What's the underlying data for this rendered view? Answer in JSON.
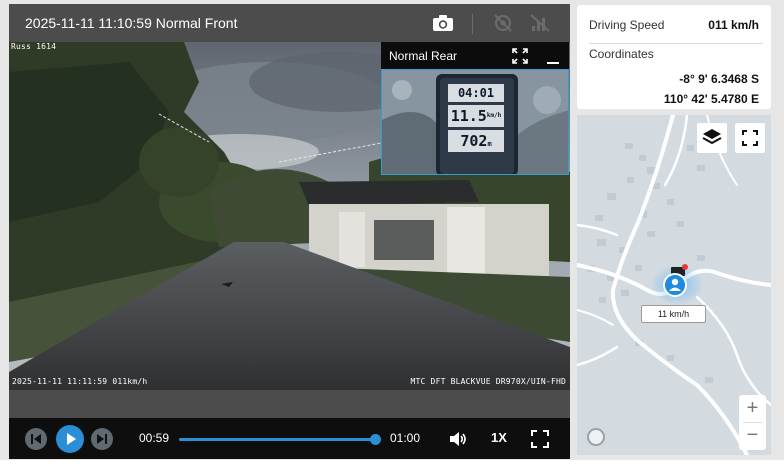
{
  "video": {
    "title": "2025-11-11 11:10:59 Normal Front",
    "osd_corner": "Russ 1614",
    "osd_left": "2025-11-11 11:11:59 011km/h",
    "osd_right": "MTC DFT BLACKVUE DR970X/UIN-FHD",
    "toolbar_icons": [
      "camera-icon",
      "no-gps-icon",
      "no-signal-icon"
    ]
  },
  "rear": {
    "title": "Normal Rear",
    "gauge_time": "04:01",
    "gauge_speed": "11.5",
    "gauge_speed_unit": "km/h",
    "gauge_distance": "702",
    "gauge_distance_unit": "m"
  },
  "controls": {
    "current_time": "00:59",
    "total_time": "01:00",
    "progress": 0.983,
    "playback_rate": "1X"
  },
  "info": {
    "speed_label": "Driving Speed",
    "speed_value": "011 km/h",
    "coordinates_label": "Coordinates",
    "latitude": "-8° 9' 6.3468 S",
    "longitude": "110° 42' 5.4780 E"
  },
  "map": {
    "speed_label": "11 km/h",
    "zoom_in": "+",
    "zoom_out": "−"
  },
  "colors": {
    "accent": "#2c8fd6",
    "topbar": "#4c4c4c",
    "controls_bg": "#0e0e0e",
    "map_bg": "#d3dbe1"
  }
}
